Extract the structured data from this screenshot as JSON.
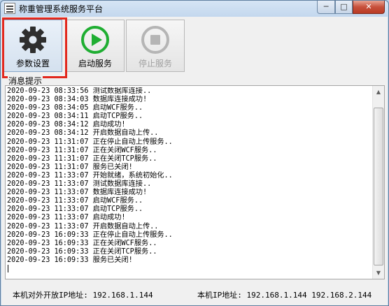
{
  "window": {
    "title": "称重管理系统服务平台",
    "minimize_label": "─",
    "maximize_label": "□",
    "close_label": "✕"
  },
  "toolbar": {
    "settings_label": "参数设置",
    "start_label": "启动服务",
    "stop_label": "停止服务",
    "stop_enabled": false
  },
  "log": {
    "group_label": "消息提示",
    "lines": [
      "2020-09-23 08:33:56 测试数据库连接..",
      "2020-09-23 08:34:03 数据库连接成功!",
      "2020-09-23 08:34:05 启动WCF服务..",
      "2020-09-23 08:34:11 启动TCP服务..",
      "2020-09-23 08:34:12 启动成功!",
      "2020-09-23 08:34:12 开启数据自动上传..",
      "2020-09-23 11:31:07 正在停止自动上传服务..",
      "2020-09-23 11:31:07 正在关闭WCF服务..",
      "2020-09-23 11:31:07 正在关闭TCP服务..",
      "2020-09-23 11:31:07 服务已关闭!",
      "2020-09-23 11:33:07 开始就绪，系统初始化..",
      "2020-09-23 11:33:07 测试数据库连接..",
      "2020-09-23 11:33:07 数据库连接成功!",
      "2020-09-23 11:33:07 启动WCF服务..",
      "2020-09-23 11:33:07 启动TCP服务..",
      "2020-09-23 11:33:07 启动成功!",
      "2020-09-23 11:33:07 开启数据自动上传..",
      "2020-09-23 16:09:33 正在停止自动上传服务..",
      "2020-09-23 16:09:33 正在关闭WCF服务..",
      "2020-09-23 16:09:33 正在关闭TCP服务..",
      "2020-09-23 16:09:33 服务已关闭!"
    ]
  },
  "status": {
    "external_ip_label": "本机对外开放IP地址: 192.168.1.144",
    "local_ip_label": "本机IP地址: 192.168.1.144 192.168.2.144"
  },
  "colors": {
    "highlight": "#e2281e",
    "start_green": "#1fae32",
    "gear_dark": "#2e2e2e",
    "stop_gray": "#b5b5b5"
  },
  "icons": {
    "settings": "gear-icon",
    "start": "play-icon",
    "stop": "stop-icon"
  }
}
